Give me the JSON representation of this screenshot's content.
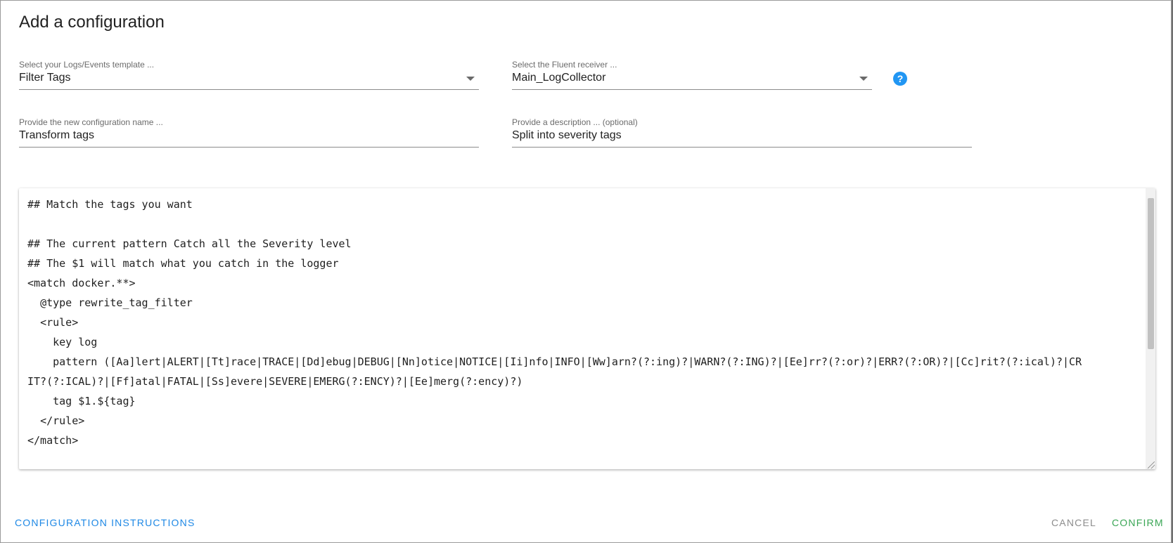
{
  "dialog": {
    "title": "Add a configuration"
  },
  "form": {
    "template": {
      "label": "Select your Logs/Events template ...",
      "value": "Filter Tags"
    },
    "receiver": {
      "label": "Select the Fluent receiver ...",
      "value": "Main_LogCollector"
    },
    "name": {
      "label": "Provide the new configuration name ...",
      "value": "Transform tags"
    },
    "description": {
      "label": "Provide a description ... (optional)",
      "value": "Split into severity tags"
    }
  },
  "editor": {
    "content": "## Match the tags you want\n\n## The current pattern Catch all the Severity level\n## The $1 will match what you catch in the logger\n<match docker.**>\n  @type rewrite_tag_filter\n  <rule>\n    key log\n    pattern ([Aa]lert|ALERT|[Tt]race|TRACE|[Dd]ebug|DEBUG|[Nn]otice|NOTICE|[Ii]nfo|INFO|[Ww]arn?(?:ing)?|WARN?(?:ING)?|[Ee]rr?(?:or)?|ERR?(?:OR)?|[Cc]rit?(?:ical)?|CRIT?(?:ICAL)?|[Ff]atal|FATAL|[Ss]evere|SEVERE|EMERG(?:ENCY)?|[Ee]merg(?:ency)?)\n    tag $1.${tag}\n  </rule>\n</match>"
  },
  "icons": {
    "help": "?"
  },
  "actions": {
    "instructions": "CONFIGURATION INSTRUCTIONS",
    "cancel": "CANCEL",
    "confirm": "CONFIRM"
  },
  "colors": {
    "accent": "#1e88e5",
    "help_icon": "#2196f3",
    "confirm": "#3aa655",
    "cancel": "#8d8d8d"
  }
}
